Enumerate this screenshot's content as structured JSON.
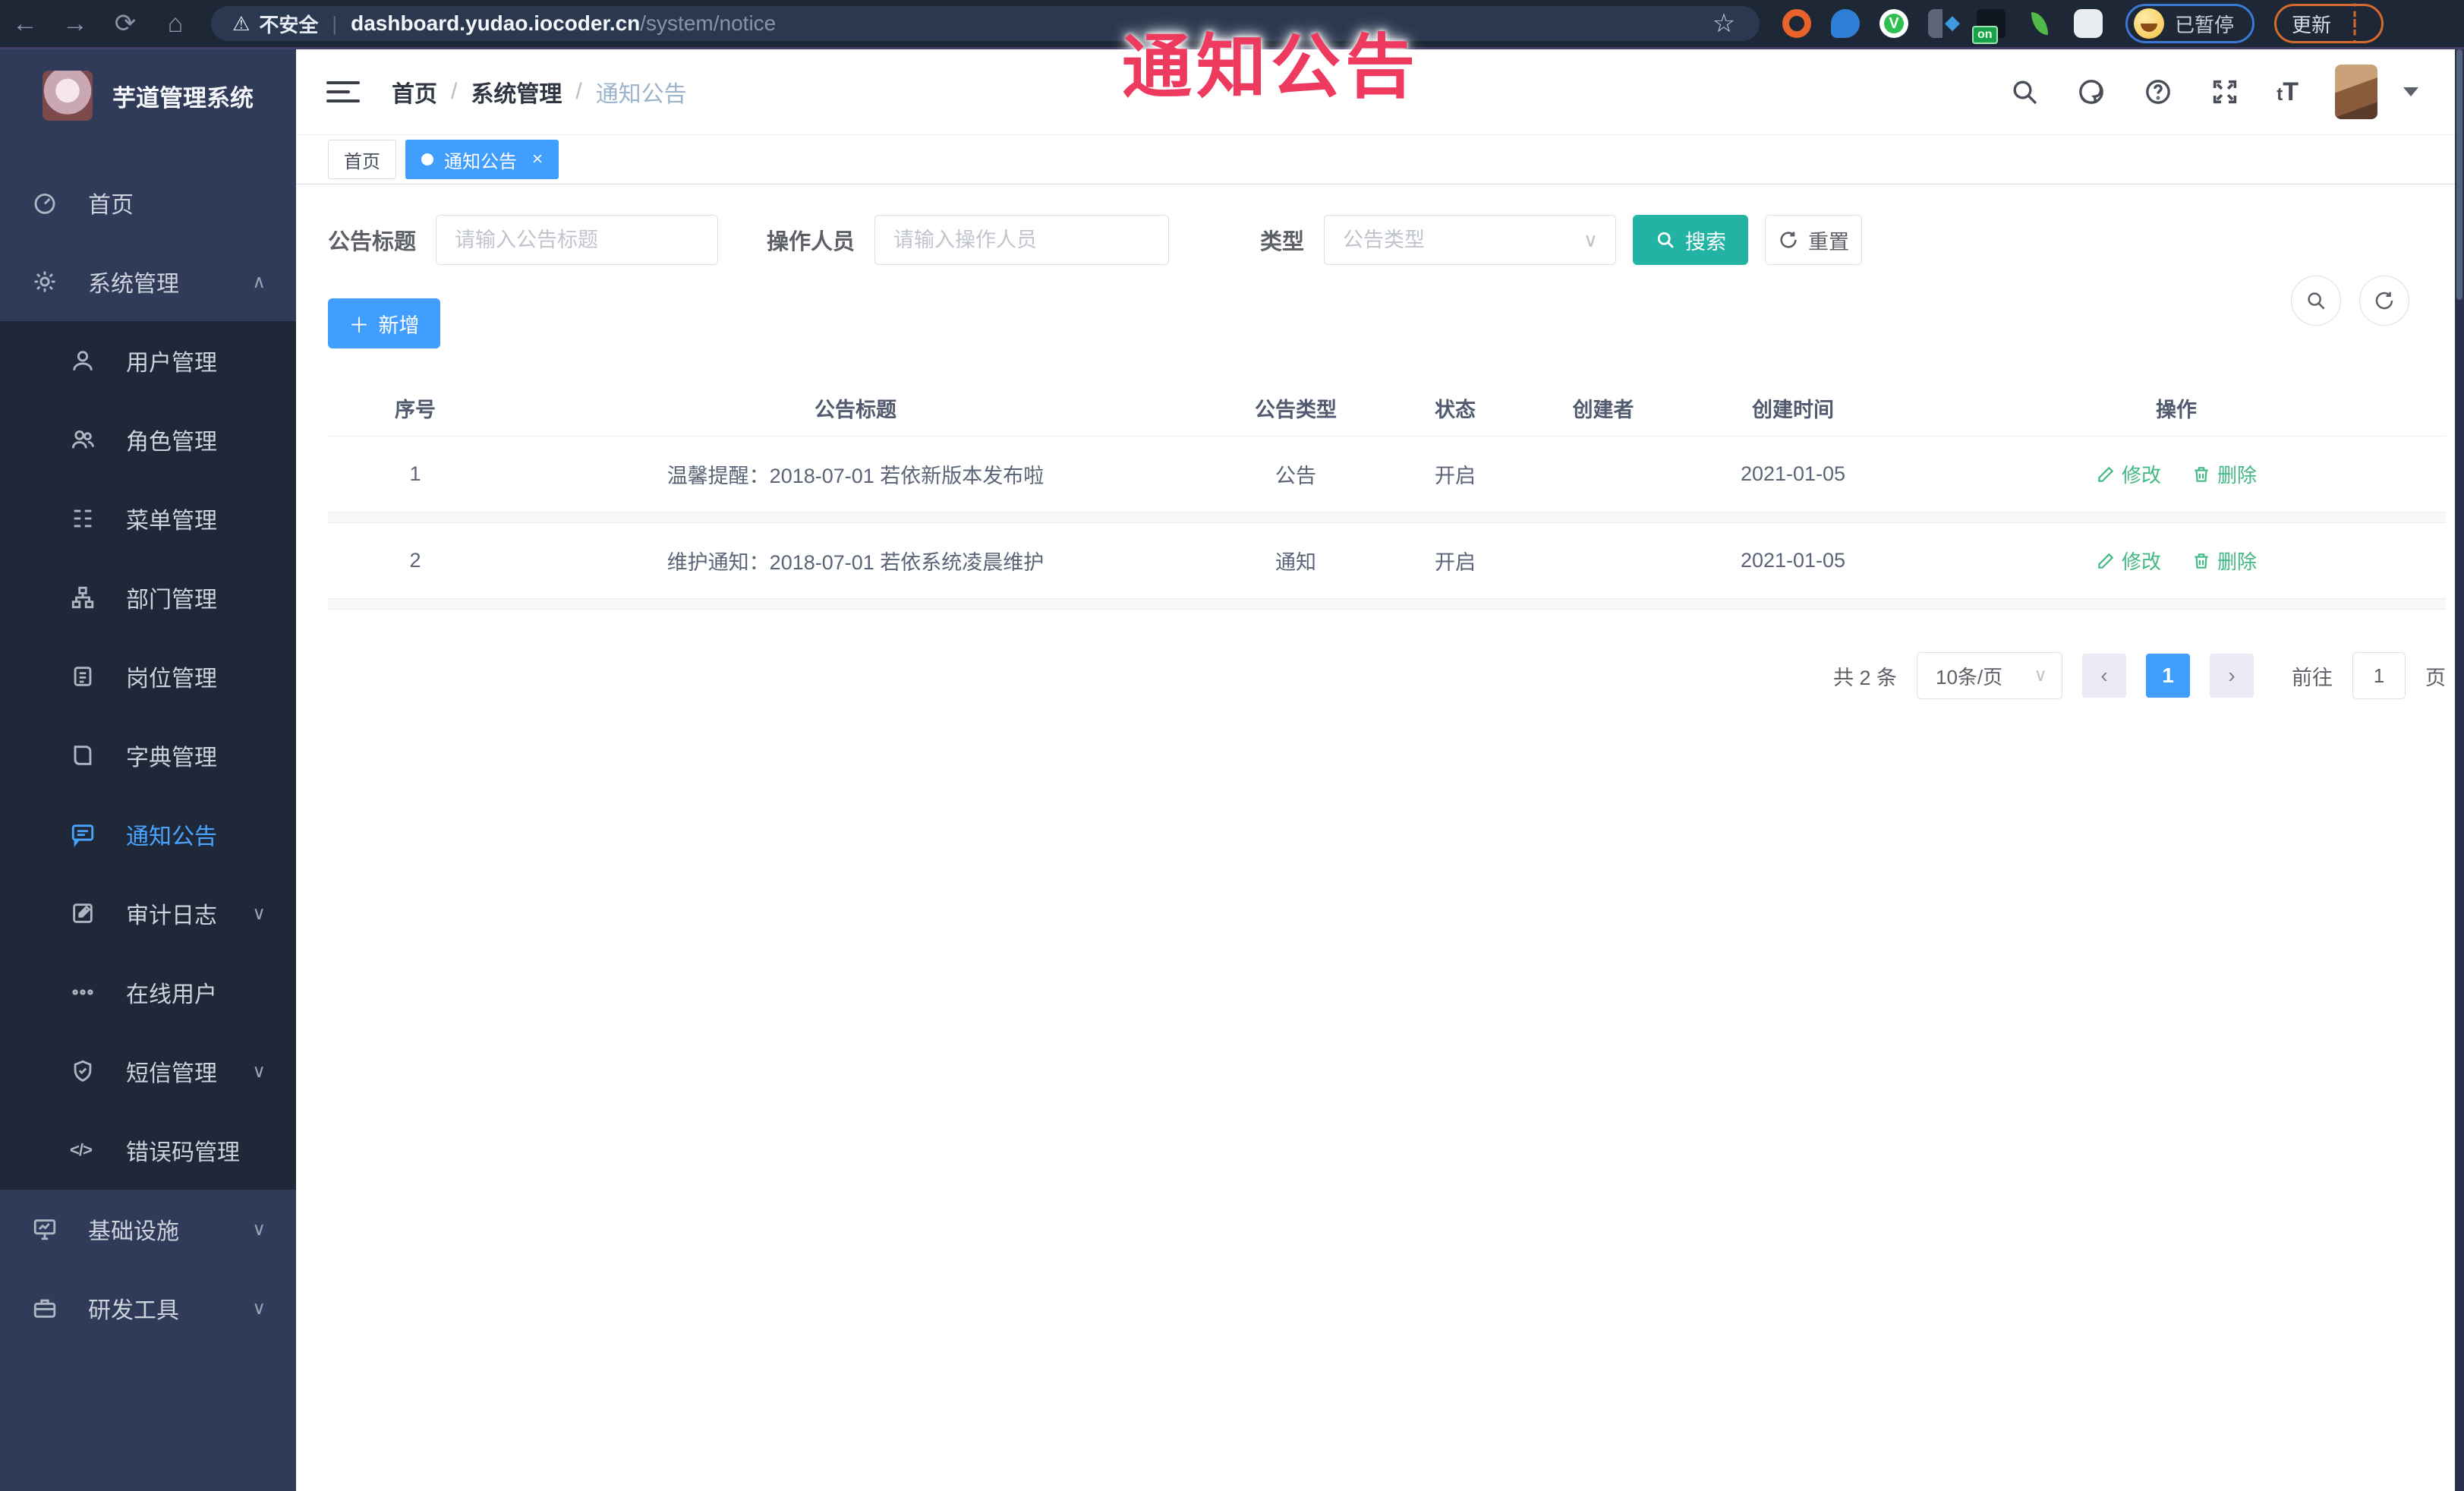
{
  "overlay": {
    "text": "通知公告"
  },
  "browser": {
    "security_label": "不安全",
    "url_host": "dashboard.yudao.iocoder.cn",
    "url_path": "/system/notice",
    "extension_on_badge": "on",
    "profile_status": "已暂停",
    "update_label": "更新"
  },
  "app": {
    "title": "芋道管理系统"
  },
  "sidebar": {
    "items": [
      {
        "label": "首页"
      },
      {
        "label": "系统管理"
      },
      {
        "label": "用户管理"
      },
      {
        "label": "角色管理"
      },
      {
        "label": "菜单管理"
      },
      {
        "label": "部门管理"
      },
      {
        "label": "岗位管理"
      },
      {
        "label": "字典管理"
      },
      {
        "label": "通知公告"
      },
      {
        "label": "审计日志"
      },
      {
        "label": "在线用户"
      },
      {
        "label": "短信管理"
      },
      {
        "label": "错误码管理"
      },
      {
        "label": "基础设施"
      },
      {
        "label": "研发工具"
      }
    ]
  },
  "header": {
    "breadcrumb": {
      "0": "首页",
      "1": "系统管理",
      "2": "通知公告"
    }
  },
  "tabs": {
    "0": {
      "label": "首页"
    },
    "1": {
      "label": "通知公告",
      "close": "×"
    }
  },
  "filters": {
    "title_label": "公告标题",
    "title_placeholder": "请输入公告标题",
    "operator_label": "操作人员",
    "operator_placeholder": "请输入操作人员",
    "type_label": "类型",
    "type_placeholder": "公告类型",
    "search_label": "搜索",
    "reset_label": "重置"
  },
  "toolbar": {
    "add_label": "新增"
  },
  "table": {
    "columns": {
      "seq": "序号",
      "title": "公告标题",
      "type": "公告类型",
      "status": "状态",
      "creator": "创建者",
      "created": "创建时间",
      "actions": "操作"
    },
    "rows": [
      {
        "seq": "1",
        "title": "温馨提醒：2018-07-01 若依新版本发布啦",
        "type": "公告",
        "status": "开启",
        "creator": "",
        "created": "2021-01-05"
      },
      {
        "seq": "2",
        "title": "维护通知：2018-07-01 若依系统凌晨维护",
        "type": "通知",
        "status": "开启",
        "creator": "",
        "created": "2021-01-05"
      }
    ],
    "action_edit": "修改",
    "action_delete": "删除"
  },
  "pagination": {
    "total": "共 2 条",
    "page_size": "10条/页",
    "prev": "‹",
    "current": "1",
    "next": "›",
    "goto_label": "前往",
    "goto_value": "1",
    "page_unit": "页"
  },
  "colors": {
    "accent_blue": "#409eff",
    "theme_teal": "#23b3a4",
    "action_green": "#42b983",
    "overlay_red": "#ef3a60",
    "sidebar_bg": "#2f3b59",
    "submenu_bg": "#1e2838",
    "browser_bg": "#1d2735"
  }
}
